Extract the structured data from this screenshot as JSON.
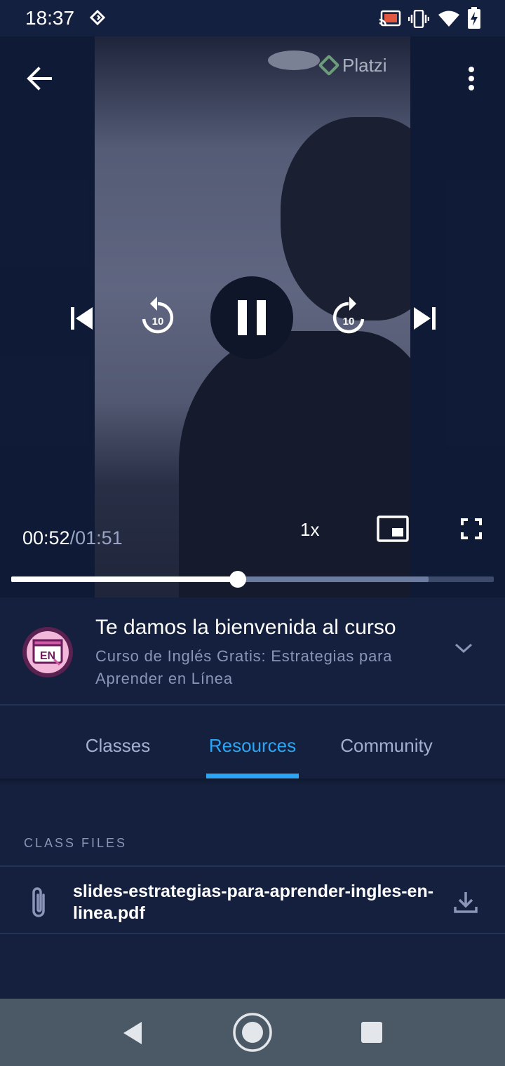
{
  "status_bar": {
    "time": "18:37"
  },
  "player": {
    "watermark": "Platzi",
    "current_time": "00:52",
    "total_time": "/01:51",
    "speed": "1x",
    "progress_fraction": 0.47,
    "buffered_fraction": 0.865,
    "rewind_seconds": "10",
    "forward_seconds": "10"
  },
  "class_info": {
    "badge_text": "EN",
    "title": "Te damos la bienvenida al curso",
    "course": "Curso de Inglés Gratis: Estrategias para Aprender en Línea"
  },
  "tabs": [
    {
      "label": "Classes",
      "active": false
    },
    {
      "label": "Resources",
      "active": true
    },
    {
      "label": "Community",
      "active": false
    }
  ],
  "resources": {
    "section_title": "CLASS FILES",
    "files": [
      {
        "name": "slides-estrategias-para-aprender-ingles-en-linea.pdf"
      }
    ]
  },
  "colors": {
    "background": "#14203d",
    "accent": "#2aa6f5",
    "muted_text": "#8a95b8"
  }
}
